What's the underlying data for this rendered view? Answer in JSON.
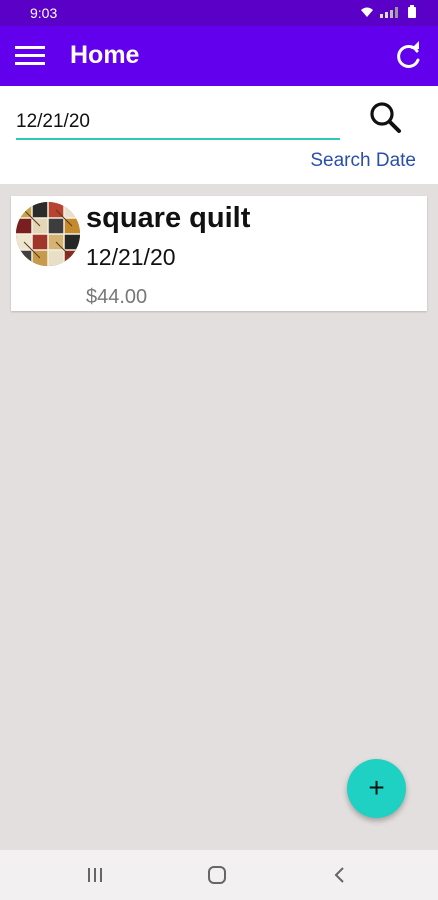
{
  "status_bar": {
    "time": "9:03",
    "icons": [
      "wifi-icon",
      "signal-icon",
      "battery-icon"
    ]
  },
  "app_bar": {
    "title": "Home",
    "menu_icon": "hamburger-menu-icon",
    "refresh_icon": "refresh-icon",
    "color": "#6200ee"
  },
  "search": {
    "value": "12/21/20",
    "search_icon": "search-icon",
    "link_label": "Search Date",
    "accent": "#2ec9b7"
  },
  "items": [
    {
      "title": "square quilt",
      "date": "12/21/20",
      "price": "$44.00",
      "thumbnail": "quilt-thumbnail"
    }
  ],
  "fab": {
    "label": "+",
    "color": "#1fd1c2"
  },
  "nav_bar": {
    "icons": [
      "recent-apps-icon",
      "home-icon",
      "back-icon"
    ]
  }
}
